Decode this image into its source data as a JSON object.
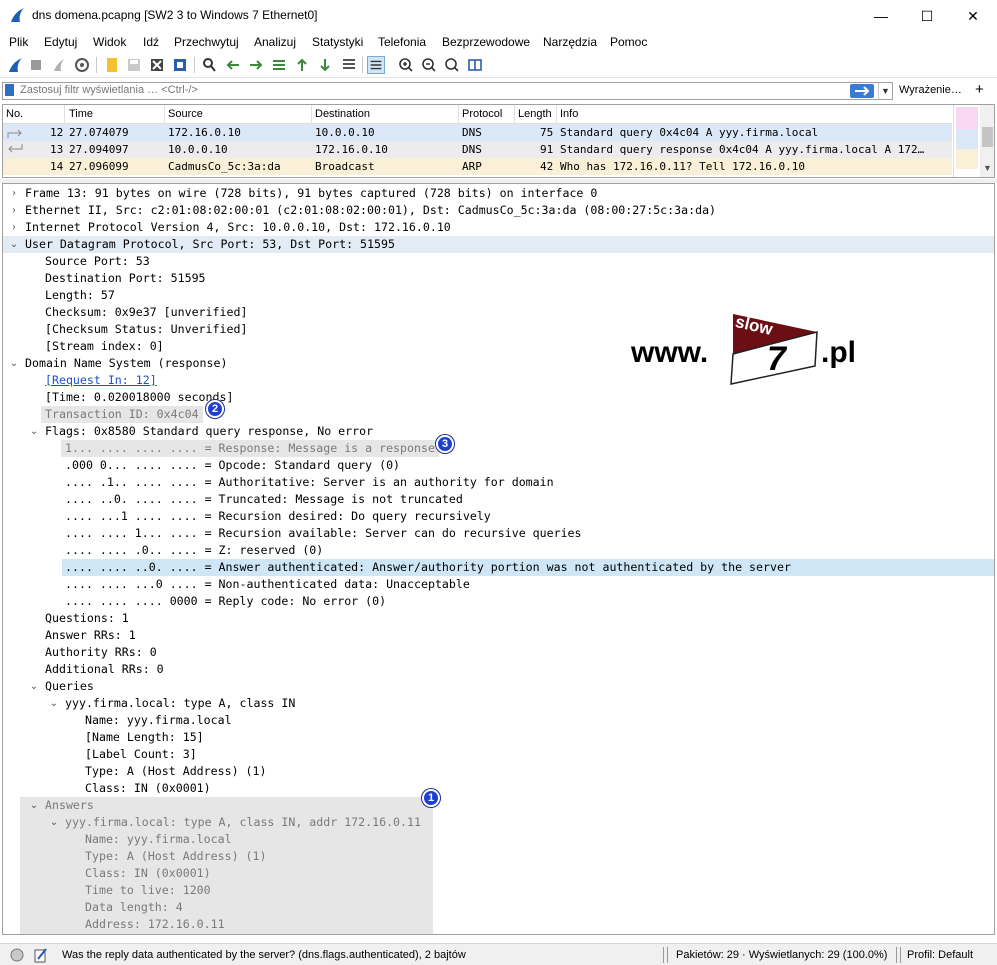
{
  "window": {
    "title": "dns domena.pcapng [SW2 3 to Windows 7 Ethernet0]",
    "minimize": "—",
    "maximize": "☐",
    "close": "✕"
  },
  "menu": [
    "Plik",
    "Edytuj",
    "Widok",
    "Idź",
    "Przechwytuj",
    "Analizuj",
    "Statystyki",
    "Telefonia",
    "Bezprzewodowe",
    "Narzędzia",
    "Pomoc"
  ],
  "filter": {
    "placeholder": "Zastosuj filtr wyświetlania … <Ctrl-/>",
    "expression_label": "Wyrażenie…",
    "plus_label": "+"
  },
  "packet_list": {
    "columns": [
      "No.",
      "Time",
      "Source",
      "Destination",
      "Protocol",
      "Length",
      "Info"
    ],
    "rows": [
      {
        "no": "12",
        "time": "27.074079",
        "source": "172.16.0.10",
        "destination": "10.0.0.10",
        "protocol": "DNS",
        "length": "75",
        "info": "Standard query 0x4c04 A yyy.firma.local",
        "bg": "#dae8f8"
      },
      {
        "no": "13",
        "time": "27.094097",
        "source": "10.0.0.10",
        "destination": "172.16.0.10",
        "protocol": "DNS",
        "length": "91",
        "info": "Standard query response 0x4c04 A yyy.firma.local A 172…",
        "bg": "#ececec"
      },
      {
        "no": "14",
        "time": "27.096099",
        "source": "CadmusCo_5c:3a:da",
        "destination": "Broadcast",
        "protocol": "ARP",
        "length": "42",
        "info": "Who has 172.16.0.11? Tell 172.16.0.10",
        "bg": "#faf0d7"
      }
    ]
  },
  "details": {
    "frame": "Frame 13: 91 bytes on wire (728 bits), 91 bytes captured (728 bits) on interface 0",
    "ethernet": "Ethernet II, Src: c2:01:08:02:00:01 (c2:01:08:02:00:01), Dst: CadmusCo_5c:3a:da (08:00:27:5c:3a:da)",
    "ip": "Internet Protocol Version 4, Src: 10.0.0.10, Dst: 172.16.0.10",
    "udp": "User Datagram Protocol, Src Port: 53, Dst Port: 51595",
    "udp_fields": [
      "Source Port: 53",
      "Destination Port: 51595",
      "Length: 57",
      "Checksum: 0x9e37 [unverified]",
      "[Checksum Status: Unverified]",
      "[Stream index: 0]"
    ],
    "dns": "Domain Name System (response)",
    "request_in": "[Request In: 12]",
    "time": "[Time: 0.020018000 seconds]",
    "transaction_id": "Transaction ID: 0x4c04",
    "flags": "Flags: 0x8580 Standard query response, No error",
    "flag_fields": [
      "1... .... .... .... = Response: Message is a response",
      ".000 0... .... .... = Opcode: Standard query (0)",
      ".... .1.. .... .... = Authoritative: Server is an authority for domain",
      ".... ..0. .... .... = Truncated: Message is not truncated",
      ".... ...1 .... .... = Recursion desired: Do query recursively",
      ".... .... 1... .... = Recursion available: Server can do recursive queries",
      ".... .... .0.. .... = Z: reserved (0)",
      ".... .... ..0. .... = Answer authenticated: Answer/authority portion was not authenticated by the server",
      ".... .... ...0 .... = Non-authenticated data: Unacceptable",
      ".... .... .... 0000 = Reply code: No error (0)"
    ],
    "counts": [
      "Questions: 1",
      "Answer RRs: 1",
      "Authority RRs: 0",
      "Additional RRs: 0"
    ],
    "queries": "Queries",
    "query": "yyy.firma.local: type A, class IN",
    "query_fields": [
      "Name: yyy.firma.local",
      "[Name Length: 15]",
      "[Label Count: 3]",
      "Type: A (Host Address) (1)",
      "Class: IN (0x0001)"
    ],
    "answers": "Answers",
    "answer": "yyy.firma.local: type A, class IN, addr 172.16.0.11",
    "answer_fields": [
      "Name: yyy.firma.local",
      "Type: A (Host Address) (1)",
      "Class: IN (0x0001)",
      "Time to live: 1200",
      "Data length: 4",
      "Address: 172.16.0.11"
    ]
  },
  "badges": [
    "1",
    "2",
    "3"
  ],
  "watermark": {
    "prefix": "www.",
    "top": "slow",
    "bottom": "7",
    "suffix": ".pl"
  },
  "status": {
    "message": "Was the reply data authenticated by the server? (dns.flags.authenticated), 2 bajtów",
    "packets": "Pakietów: 29 · Wyświetlanych: 29 (100.0%)",
    "profile": "Profil: Default"
  },
  "colors": {
    "selected_line": "#cfe6f7",
    "badge": "#1e3fd4",
    "link": "#1f4fcf"
  }
}
